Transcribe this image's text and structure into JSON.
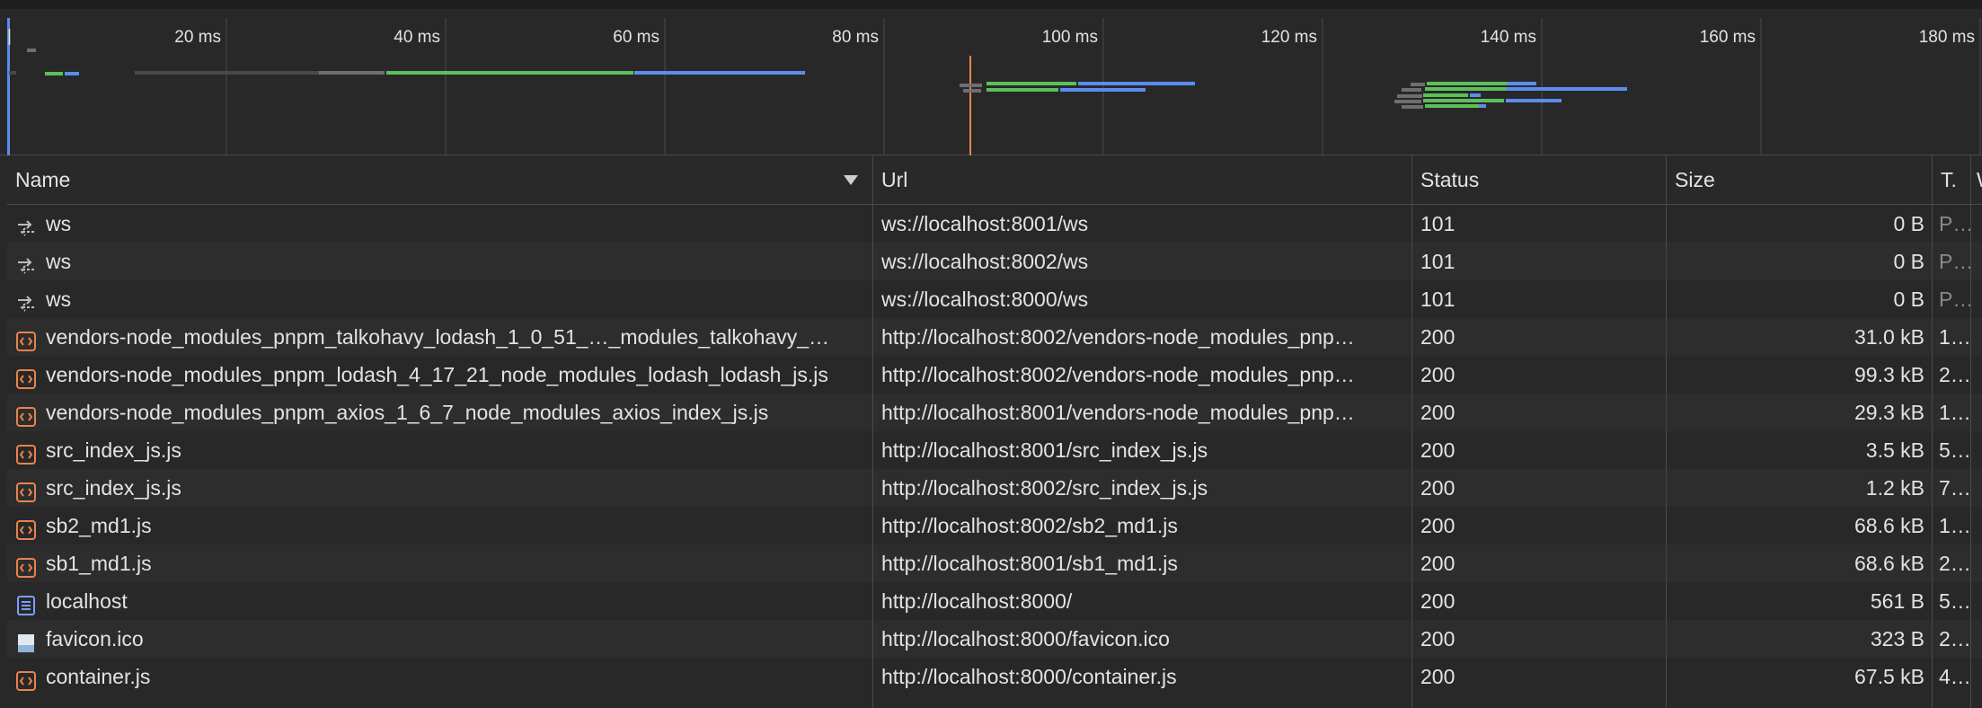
{
  "timeline": {
    "ticks": [
      "20 ms",
      "40 ms",
      "60 ms",
      "80 ms",
      "100 ms",
      "120 ms",
      "140 ms",
      "160 ms",
      "180 ms"
    ],
    "marker_label": "|"
  },
  "columns": {
    "name": "Name",
    "url": "Url",
    "status": "Status",
    "size": "Size",
    "type_short": "T.",
    "extra_short": "W"
  },
  "rows": [
    {
      "icon": "websocket-icon",
      "name": "ws",
      "url": "ws://localhost:8001/ws",
      "status": "101",
      "size": "0 B",
      "time": "P…",
      "time_dim": true
    },
    {
      "icon": "websocket-icon",
      "name": "ws",
      "url": "ws://localhost:8002/ws",
      "status": "101",
      "size": "0 B",
      "time": "P…",
      "time_dim": true
    },
    {
      "icon": "websocket-icon",
      "name": "ws",
      "url": "ws://localhost:8000/ws",
      "status": "101",
      "size": "0 B",
      "time": "P…",
      "time_dim": true
    },
    {
      "icon": "script-icon",
      "name": "vendors-node_modules_pnpm_talkohavy_lodash_1_0_51_…_modules_talkohavy_…",
      "url": "http://localhost:8002/vendors-node_modules_pnp…",
      "status": "200",
      "size": "31.0 kB",
      "time": "1…",
      "time_dim": false
    },
    {
      "icon": "script-icon",
      "name": "vendors-node_modules_pnpm_lodash_4_17_21_node_modules_lodash_lodash_js.js",
      "url": "http://localhost:8002/vendors-node_modules_pnp…",
      "status": "200",
      "size": "99.3 kB",
      "time": "2…",
      "time_dim": false
    },
    {
      "icon": "script-icon",
      "name": "vendors-node_modules_pnpm_axios_1_6_7_node_modules_axios_index_js.js",
      "url": "http://localhost:8001/vendors-node_modules_pnp…",
      "status": "200",
      "size": "29.3 kB",
      "time": "1…",
      "time_dim": false
    },
    {
      "icon": "script-icon",
      "name": "src_index_js.js",
      "url": "http://localhost:8001/src_index_js.js",
      "status": "200",
      "size": "3.5 kB",
      "time": "5…",
      "time_dim": false
    },
    {
      "icon": "script-icon",
      "name": "src_index_js.js",
      "url": "http://localhost:8002/src_index_js.js",
      "status": "200",
      "size": "1.2 kB",
      "time": "7…",
      "time_dim": false
    },
    {
      "icon": "script-icon",
      "name": "sb2_md1.js",
      "url": "http://localhost:8002/sb2_md1.js",
      "status": "200",
      "size": "68.6 kB",
      "time": "1…",
      "time_dim": false
    },
    {
      "icon": "script-icon",
      "name": "sb1_md1.js",
      "url": "http://localhost:8001/sb1_md1.js",
      "status": "200",
      "size": "68.6 kB",
      "time": "2…",
      "time_dim": false
    },
    {
      "icon": "document-icon",
      "name": "localhost",
      "url": "http://localhost:8000/",
      "status": "200",
      "size": "561 B",
      "time": "5…",
      "time_dim": false
    },
    {
      "icon": "image-icon",
      "name": "favicon.ico",
      "url": "http://localhost:8000/favicon.ico",
      "status": "200",
      "size": "323 B",
      "time": "2…",
      "time_dim": false
    },
    {
      "icon": "script-icon",
      "name": "container.js",
      "url": "http://localhost:8000/container.js",
      "status": "200",
      "size": "67.5 kB",
      "time": "4…",
      "time_dim": false
    }
  ],
  "colors": {
    "waiting_bar": "#6e6e6e",
    "queue_bar": "#4a4a4a",
    "download_green": "#5cbf5c",
    "download_blue": "#5b8dee",
    "dom_marker": "#e8834e",
    "script_icon": "#e8834e",
    "document_icon": "#7a9eff"
  }
}
